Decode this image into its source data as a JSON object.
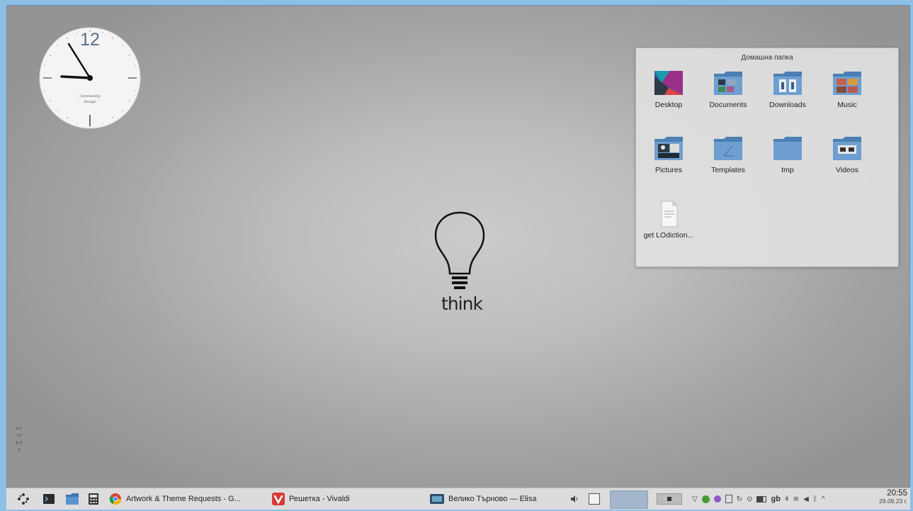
{
  "clock_widget": {
    "number": "12",
    "brand": "Community Design",
    "time_shown": "08:55"
  },
  "center_logo": {
    "text": "think"
  },
  "folder_view": {
    "title": "Домашна папка",
    "items": [
      {
        "label": "Desktop",
        "icon": "desktop-folder-icon"
      },
      {
        "label": "Documents",
        "icon": "documents-folder-icon"
      },
      {
        "label": "Downloads",
        "icon": "downloads-folder-icon"
      },
      {
        "label": "Music",
        "icon": "music-folder-icon"
      },
      {
        "label": "Pictures",
        "icon": "pictures-folder-icon"
      },
      {
        "label": "Templates",
        "icon": "templates-folder-icon"
      },
      {
        "label": "tmp",
        "icon": "folder-icon"
      },
      {
        "label": "Videos",
        "icon": "videos-folder-icon"
      },
      {
        "label": "get LOdiction...",
        "icon": "text-file-icon"
      }
    ]
  },
  "left_vertical_text": "a v r e p o p",
  "taskbar": {
    "launchers": [
      "application-launcher-icon",
      "terminal-icon",
      "file-manager-icon",
      "calculator-icon"
    ],
    "tasks": [
      {
        "label": "Artwork & Theme Requests - G...",
        "icon": "chrome-icon"
      },
      {
        "label": "Решетка - Vivaldi",
        "icon": "vivaldi-icon"
      },
      {
        "label": "Велико Търново — Elisa",
        "icon": "elisa-icon"
      }
    ],
    "tray": {
      "keyboard_layout": "gb",
      "time": "20:55",
      "date": "29.09.23 г."
    },
    "colors": {
      "accent": "#a4b6cc",
      "panel": "#dcdcdc"
    }
  }
}
